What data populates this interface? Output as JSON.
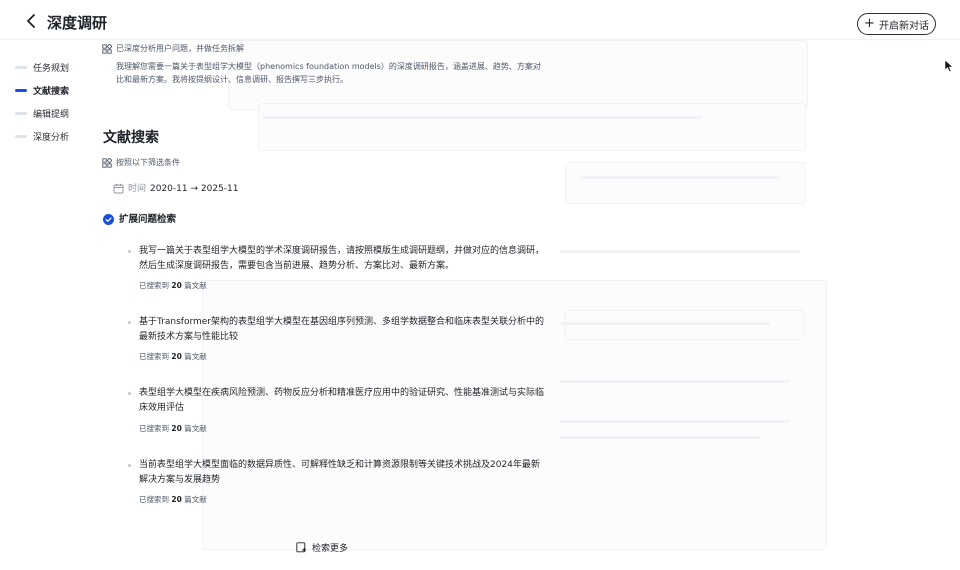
{
  "header": {
    "title": "深度调研",
    "new_chat_label": "开启新对话"
  },
  "outline": {
    "items": [
      {
        "label": "任务规划",
        "active": false
      },
      {
        "label": "文献搜索",
        "active": true
      },
      {
        "label": "编辑提纲",
        "active": false
      },
      {
        "label": "深度分析",
        "active": false
      }
    ]
  },
  "task": {
    "status": "已深度分析用户问题，并做任务拆解",
    "description": "我理解您需要一篇关于表型组学大模型（phenomics foundation models）的深度调研报告，涵盖进展、趋势、方案对比和最新方案。我将按提纲设计、信息调研、报告撰写三步执行。"
  },
  "search": {
    "title": "文献搜索",
    "filter_label": "按照以下筛选条件",
    "time_label": "时间",
    "time_range": "2020-11 → 2025-11",
    "expand_label": "扩展问题检索",
    "queries": [
      {
        "text": "我写一篇关于表型组学大模型的学术深度调研报告，请按照模版生成调研题纲，并做对应的信息调研，然后生成深度调研报告，需要包含当前进展、趋势分析、方案比对、最新方案。",
        "count_prefix": "已搜索到",
        "count": "20",
        "count_suffix": "篇文献"
      },
      {
        "text": "基于Transformer架构的表型组学大模型在基因组序列预测、多组学数据整合和临床表型关联分析中的最新技术方案与性能比较",
        "count_prefix": "已搜索到",
        "count": "20",
        "count_suffix": "篇文献"
      },
      {
        "text": "表型组学大模型在疾病风险预测、药物反应分析和精准医疗应用中的验证研究、性能基准测试与实际临床效用评估",
        "count_prefix": "已搜索到",
        "count": "20",
        "count_suffix": "篇文献"
      },
      {
        "text": "当前表型组学大模型面临的数据异质性、可解释性缺乏和计算资源限制等关键技术挑战及2024年最新解决方案与发展趋势",
        "count_prefix": "已搜索到",
        "count": "20",
        "count_suffix": "篇文献"
      }
    ],
    "more_label": "检索更多"
  },
  "colors": {
    "accent": "#1d4ed8",
    "text": "#1f2329",
    "muted": "#4e5969"
  }
}
